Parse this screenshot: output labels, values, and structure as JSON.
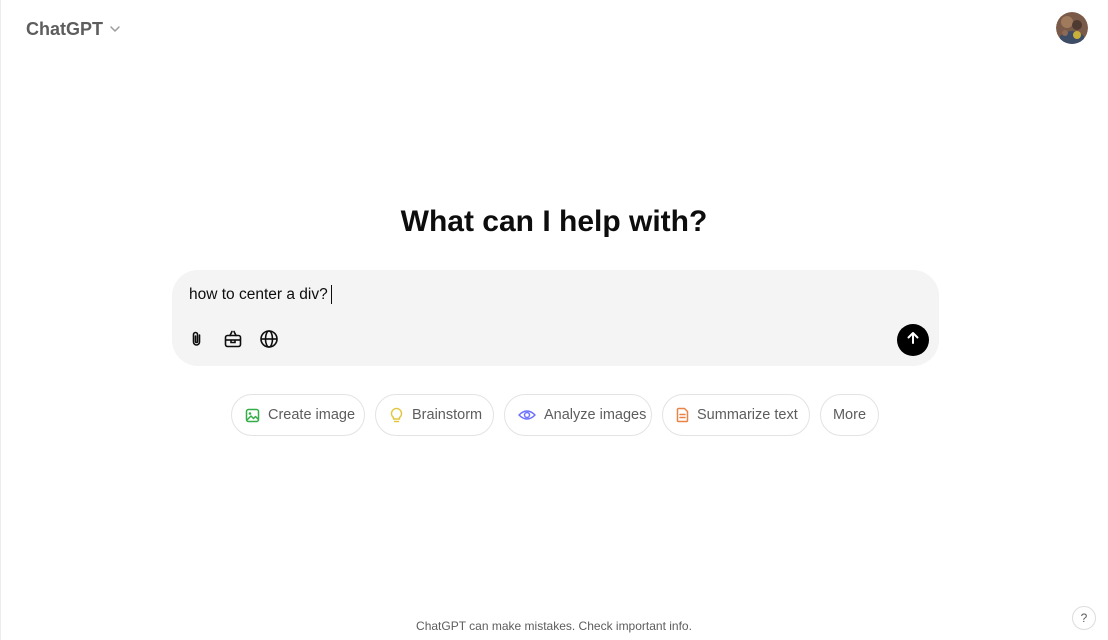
{
  "header": {
    "model_name": "ChatGPT",
    "model_dropdown_icon": "chevron-down-icon",
    "avatar_icon": "user-avatar"
  },
  "main": {
    "headline": "What can I help with?"
  },
  "composer": {
    "input_value": "how to center a div?",
    "tools": [
      {
        "icon": "paperclip-icon"
      },
      {
        "icon": "toolbox-icon"
      },
      {
        "icon": "globe-icon"
      }
    ],
    "send_icon": "arrow-up-icon"
  },
  "suggestions": [
    {
      "label": "Create image",
      "icon": "image-icon",
      "color": "#35ae47"
    },
    {
      "label": "Brainstorm",
      "icon": "lightbulb-icon",
      "color": "#e2c541"
    },
    {
      "label": "Analyze images",
      "icon": "eye-icon",
      "color": "#6c71ff"
    },
    {
      "label": "Summarize text",
      "icon": "document-icon",
      "color": "#ea8444"
    },
    {
      "label": "More"
    }
  ],
  "footer": {
    "disclaimer": "ChatGPT can make mistakes. Check important info."
  },
  "help": {
    "label": "?"
  }
}
